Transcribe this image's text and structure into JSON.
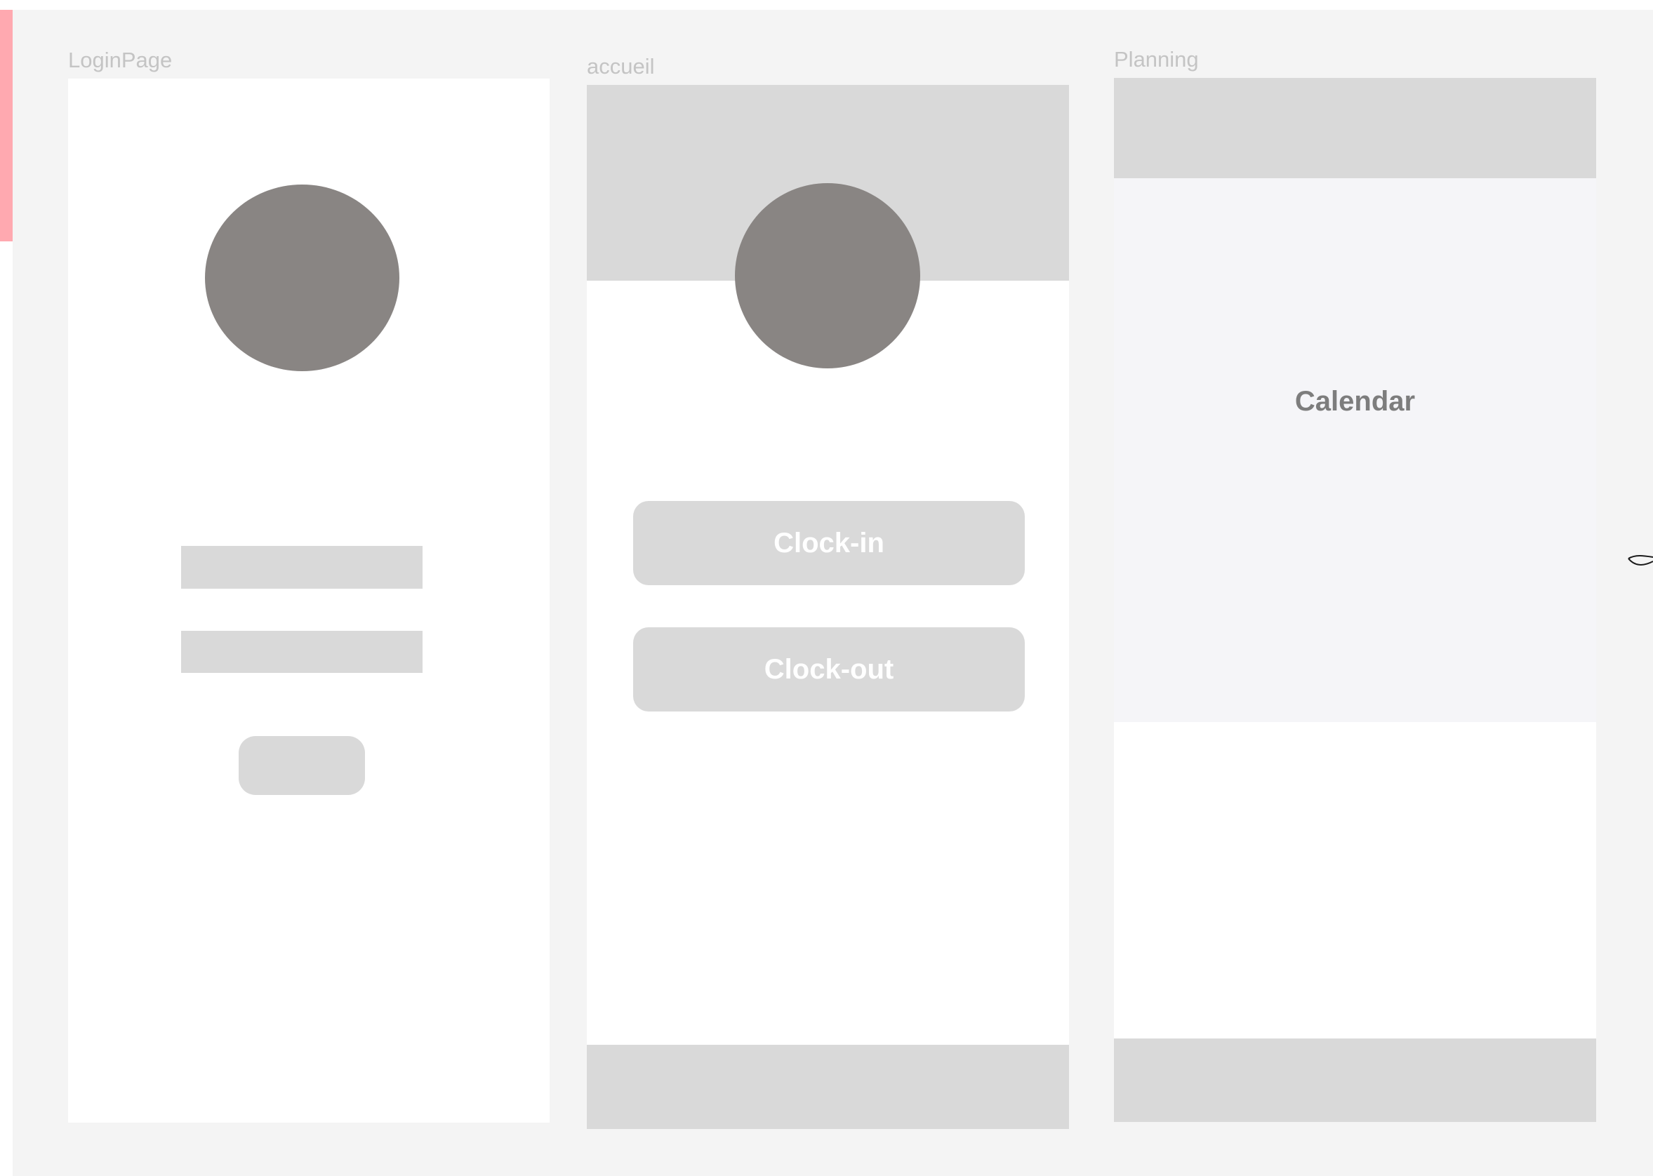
{
  "frames": {
    "login": {
      "label": "LoginPage"
    },
    "accueil": {
      "label": "accueil",
      "clock_in_label": "Clock-in",
      "clock_out_label": "Clock-out"
    },
    "planning": {
      "label": "Planning",
      "calendar_label": "Calendar"
    }
  },
  "colors": {
    "canvas_bg": "#f4f4f4",
    "placeholder": "#d9d9d9",
    "avatar": "#898583",
    "calendar_bg": "#f5f5f8",
    "accent_strip": "#ffa9b0"
  },
  "icons": {
    "connector": "curved-connector-icon"
  }
}
